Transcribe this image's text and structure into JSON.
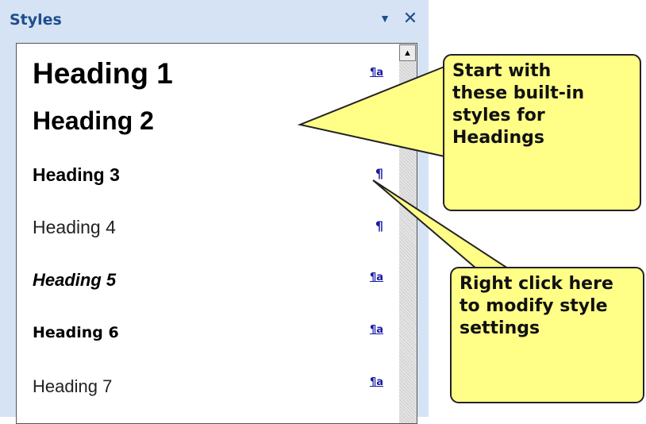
{
  "pane": {
    "title": "Styles",
    "dropdown_icon": "▼",
    "close_icon": "✕"
  },
  "styles": [
    {
      "name": "Heading 1",
      "marker": "¶a",
      "marker_type": "linked"
    },
    {
      "name": "Heading 2",
      "marker": "",
      "marker_type": "none"
    },
    {
      "name": "Heading 3",
      "marker": "¶",
      "marker_type": "paragraph"
    },
    {
      "name": "Heading 4",
      "marker": "¶",
      "marker_type": "paragraph"
    },
    {
      "name": "Heading 5",
      "marker": "¶a",
      "marker_type": "linked"
    },
    {
      "name": "Heading 6",
      "marker": "¶a",
      "marker_type": "linked"
    },
    {
      "name": "Heading 7",
      "marker": "¶a",
      "marker_type": "linked"
    }
  ],
  "scrollbar": {
    "up_arrow": "▲"
  },
  "callouts": {
    "top": [
      "Start with",
      "these built-in",
      "styles for",
      "Headings"
    ],
    "bottom": [
      "Right click here",
      "to modify style",
      "settings"
    ]
  },
  "colors": {
    "callout_fill": "#ffff88",
    "pane_bg": "#d5e3f5",
    "marker": "#1a1aa6"
  }
}
